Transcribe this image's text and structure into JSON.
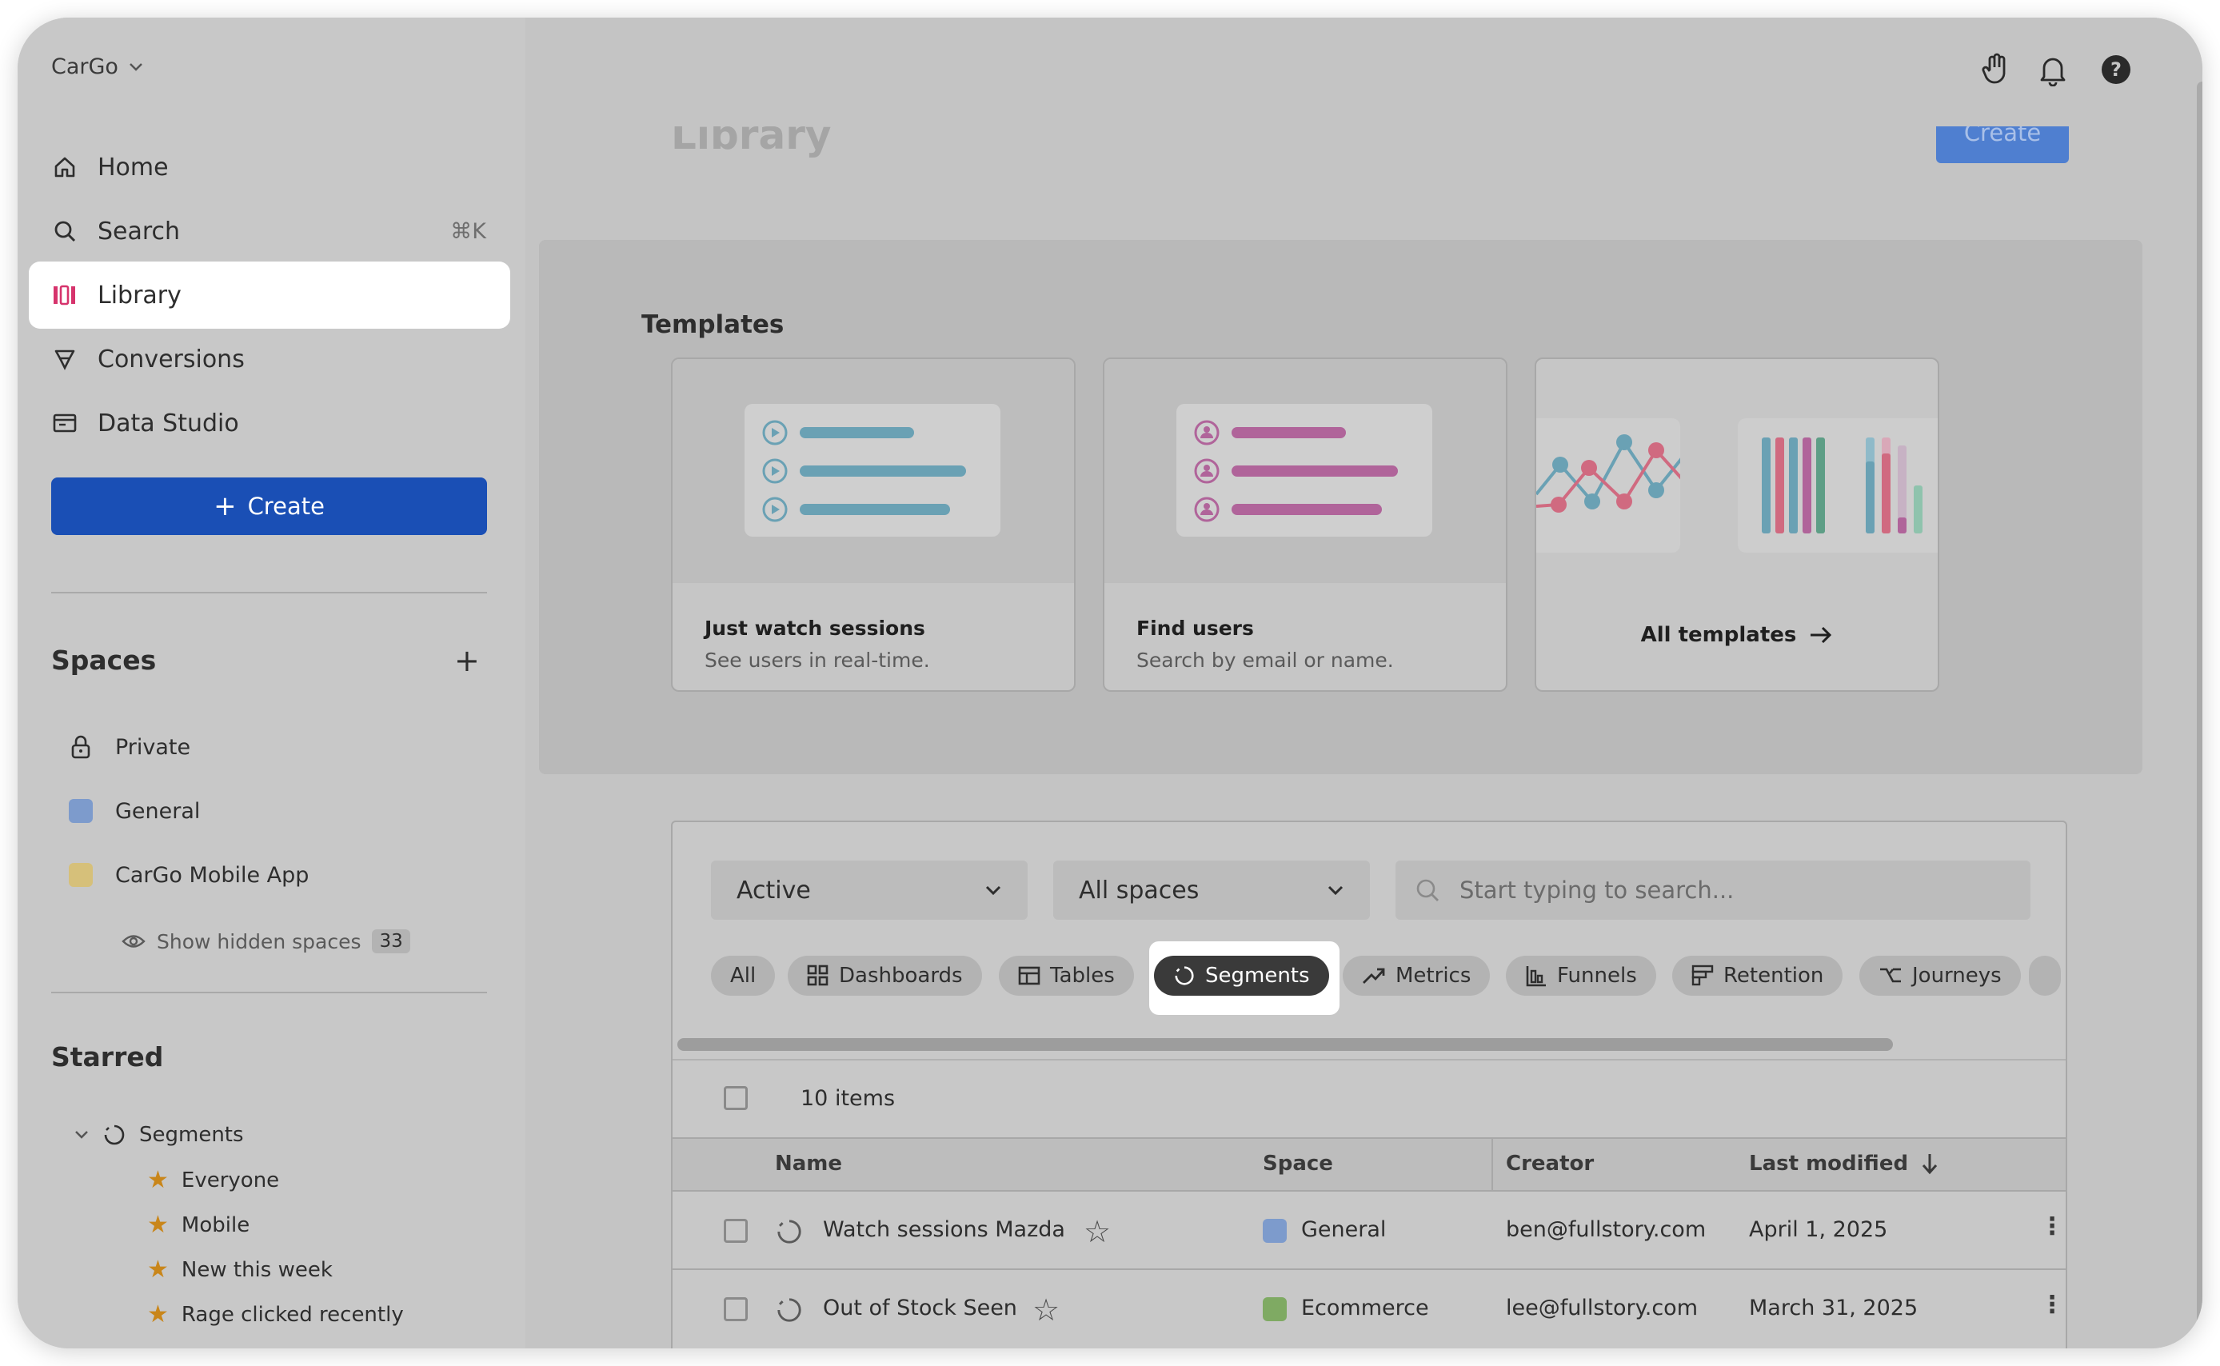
{
  "sidebar": {
    "org_name": "CarGo",
    "nav": [
      {
        "label": "Home",
        "icon": "home-icon"
      },
      {
        "label": "Search",
        "icon": "search-icon",
        "shortcut": "⌘K"
      },
      {
        "label": "Library",
        "icon": "library-icon",
        "active": true
      },
      {
        "label": "Conversions",
        "icon": "conversions-icon"
      },
      {
        "label": "Data Studio",
        "icon": "data-studio-icon"
      }
    ],
    "create_label": "Create",
    "spaces_title": "Spaces",
    "spaces": [
      {
        "label": "Private",
        "icon": "lock-icon"
      },
      {
        "label": "General",
        "color": "#7d9bcc"
      },
      {
        "label": "CarGo Mobile App",
        "color": "#d6c07a"
      }
    ],
    "show_hidden_label": "Show hidden spaces",
    "hidden_count": "33",
    "starred_title": "Starred",
    "starred_group": "Segments",
    "starred_items": [
      "Everyone",
      "Mobile",
      "New this week",
      "Rage clicked recently"
    ]
  },
  "header": {
    "page_title": "Library",
    "create_label": "Create"
  },
  "templates": {
    "title": "Templates",
    "cards": [
      {
        "title": "Just watch sessions",
        "subtitle": "See users in real-time."
      },
      {
        "title": "Find users",
        "subtitle": "Search by email or name."
      }
    ],
    "all_label": "All templates"
  },
  "library": {
    "status_filter": "Active",
    "space_filter": "All spaces",
    "search_placeholder": "Start typing to search...",
    "chips": [
      "All",
      "Dashboards",
      "Tables",
      "Segments",
      "Metrics",
      "Funnels",
      "Retention",
      "Journeys"
    ],
    "selected_chip": "Segments",
    "item_count": "10 items",
    "columns": {
      "name": "Name",
      "space": "Space",
      "creator": "Creator",
      "modified": "Last modified"
    },
    "rows": [
      {
        "name": "Watch sessions Mazda",
        "space": "General",
        "space_color": "#7d9bcc",
        "creator": "ben@fullstory.com",
        "modified": "April 1, 2025"
      },
      {
        "name": "Out of Stock Seen",
        "space": "Ecommerce",
        "space_color": "#7faa63",
        "creator": "lee@fullstory.com",
        "modified": "March 31, 2025"
      }
    ]
  },
  "colors": {
    "accent": "#1a4fb5",
    "library_pink": "#d6336c"
  }
}
